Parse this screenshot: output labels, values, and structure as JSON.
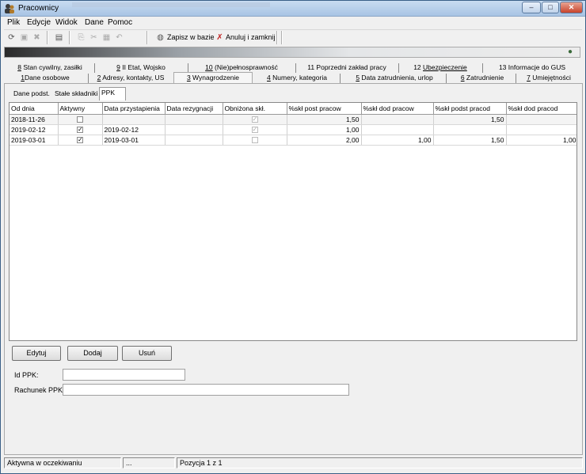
{
  "window": {
    "title": "Pracownicy"
  },
  "menu": [
    "Plik",
    "Edycje",
    "Widok",
    "Dane",
    "Pomoc"
  ],
  "toolbar": {
    "save_label": "Zapisz w bazie",
    "cancel_label": "Anuluj i zamknij"
  },
  "tabs_top": [
    {
      "num": "8",
      "label": "Stan cywilny, zasiłki"
    },
    {
      "num": "9",
      "label": "II Etat, Wojsko"
    },
    {
      "num": "10",
      "label": "(Nie)pełnosprawność"
    },
    {
      "num": "11",
      "label": "Poprzedni zakład pracy"
    },
    {
      "num": "12",
      "label": "Ubezpieczenie"
    },
    {
      "num": "13",
      "label": "Informacje do GUS"
    }
  ],
  "tabs_bottom": [
    {
      "num": "1",
      "label": "Dane osobowe"
    },
    {
      "num": "2",
      "label": "Adresy, kontakty, US"
    },
    {
      "num": "3",
      "label": "Wynagrodzenie"
    },
    {
      "num": "4",
      "label": "Numery, kategoria"
    },
    {
      "num": "5",
      "label": "Data zatrudnienia, urlop"
    },
    {
      "num": "6",
      "label": "Zatrudnienie"
    },
    {
      "num": "7",
      "label": "Umiejętności"
    }
  ],
  "subtabs": [
    "Dane podst.",
    "Stałe składniki",
    "PPK"
  ],
  "table": {
    "columns": [
      "Od dnia",
      "Aktywny",
      "Data przystapienia",
      "Data rezygnacji",
      "Obniżona skł.",
      "%skł post pracow",
      "%skł dod pracow",
      "%skł podst pracod",
      "%skł dod pracod"
    ],
    "rows": [
      {
        "od_dnia": "2018-11-26",
        "aktywny": false,
        "data_przyst": "",
        "data_rez": "",
        "obnizona": true,
        "post_pracow": "1,50",
        "dod_pracow": "",
        "podst_pracod": "1,50",
        "dod_pracod": ""
      },
      {
        "od_dnia": "2019-02-12",
        "aktywny": true,
        "data_przyst": "2019-02-12",
        "data_rez": "",
        "obnizona": true,
        "post_pracow": "1,00",
        "dod_pracow": "",
        "podst_pracod": "",
        "dod_pracod": ""
      },
      {
        "od_dnia": "2019-03-01",
        "aktywny": true,
        "data_przyst": "2019-03-01",
        "data_rez": "",
        "obnizona": false,
        "post_pracow": "2,00",
        "dod_pracow": "1,00",
        "podst_pracod": "1,50",
        "dod_pracod": "1,00"
      }
    ]
  },
  "buttons": {
    "edit": "Edytuj",
    "add": "Dodaj",
    "delete": "Usuń"
  },
  "fields": {
    "id_ppk": {
      "label": "Id PPK:",
      "value": ""
    },
    "rachunek_ppk": {
      "label": "Rachunek PPK:",
      "value": ""
    }
  },
  "status": {
    "state": "Aktywna w oczekiwaniu",
    "middle": "...",
    "position": "Pozycja 1 z 1"
  }
}
